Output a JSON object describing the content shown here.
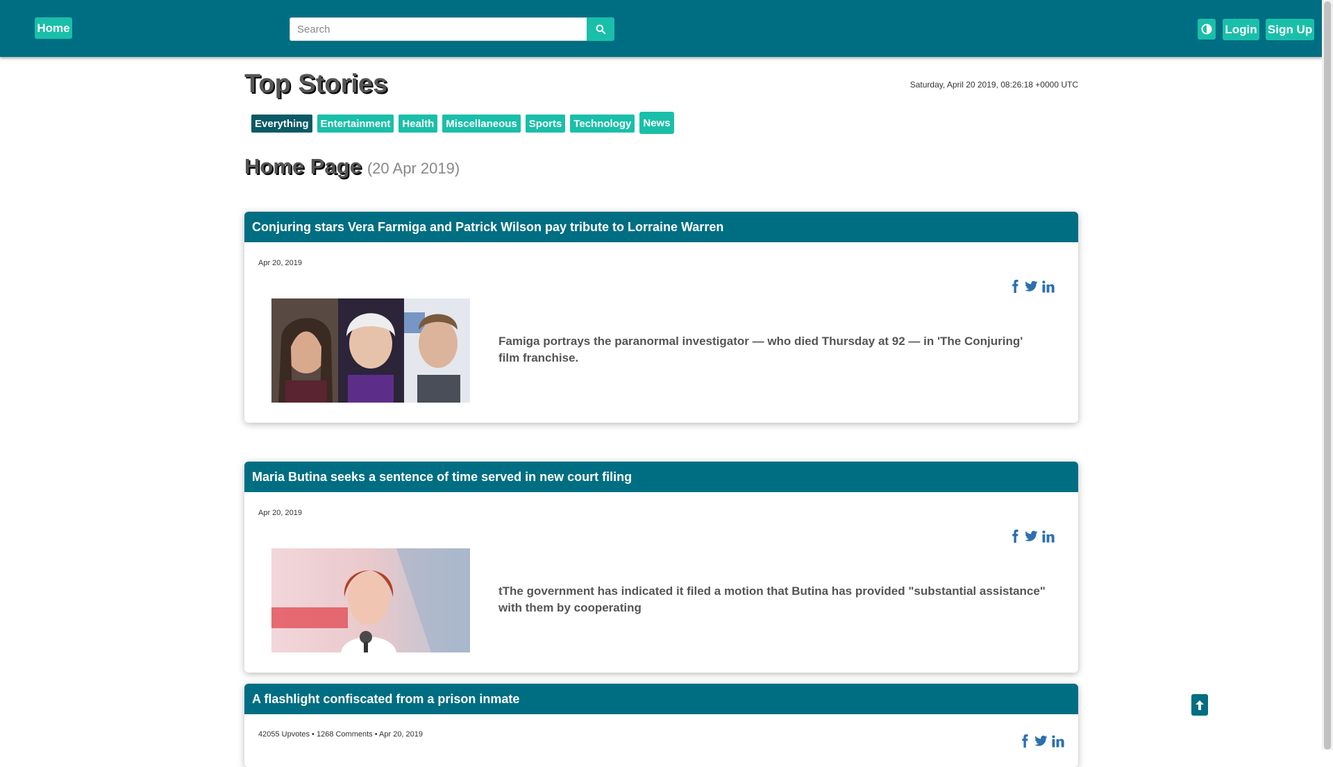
{
  "navbar": {
    "home_label": "Home",
    "search_placeholder": "Search",
    "search_value": "",
    "login_label": "Login",
    "signup_label": "Sign Up",
    "colors": {
      "bar": "#006e82",
      "accent": "#1abfa9"
    },
    "icons": [
      "search-icon",
      "contrast-icon"
    ]
  },
  "page": {
    "title": "Top Stories",
    "datetime": "Saturday, April 20 2019, 08:26:18 +0000 UTC",
    "categories": [
      "Everything",
      "Entertainment",
      "Health",
      "Miscellaneous",
      "Sports",
      "Technology",
      "News"
    ],
    "active_category": "Everything",
    "section_title": "Home Page",
    "section_date": "(20 Apr 2019)"
  },
  "stories": [
    {
      "title": "Conjuring stars Vera Farmiga and Patrick Wilson pay tribute to Lorraine Warren",
      "meta": "Apr 20, 2019",
      "summary": "Famiga portrays the paranormal investigator — who died Thursday at 92 — in 'The Conjuring' film franchise.",
      "image": "three-portraits-photo"
    },
    {
      "title": "Maria Butina seeks a sentence of time served in new court filing",
      "meta": "Apr 20, 2019",
      "summary": "tThe government has indicated it filed a motion that Butina has provided \"substantial assistance\" with them by cooperating",
      "image": "speaker-at-microphone-photo"
    },
    {
      "title": "A flashlight confiscated from a prison inmate",
      "meta": "42055 Upvotes • 1268 Comments • Apr 20, 2019"
    }
  ],
  "social_icons": [
    "facebook-icon",
    "twitter-icon",
    "linkedin-icon"
  ],
  "social_color": "#2c6fb0"
}
